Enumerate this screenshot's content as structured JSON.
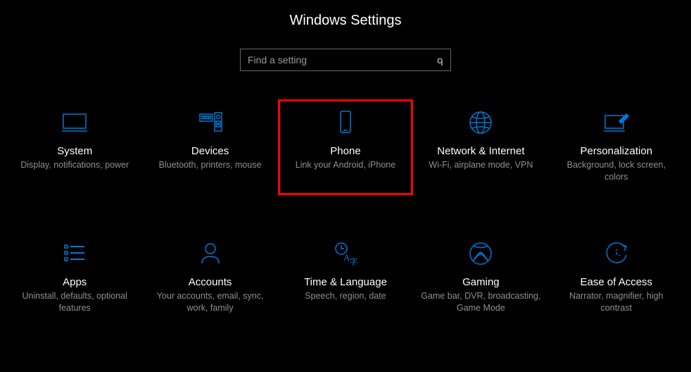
{
  "title": "Windows Settings",
  "search": {
    "placeholder": "Find a setting"
  },
  "tiles": [
    {
      "id": "system",
      "title": "System",
      "desc": "Display, notifications, power",
      "highlighted": false
    },
    {
      "id": "devices",
      "title": "Devices",
      "desc": "Bluetooth, printers, mouse",
      "highlighted": false
    },
    {
      "id": "phone",
      "title": "Phone",
      "desc": "Link your Android, iPhone",
      "highlighted": true
    },
    {
      "id": "network",
      "title": "Network & Internet",
      "desc": "Wi-Fi, airplane mode, VPN",
      "highlighted": false
    },
    {
      "id": "personalization",
      "title": "Personalization",
      "desc": "Background, lock screen, colors",
      "highlighted": false
    },
    {
      "id": "apps",
      "title": "Apps",
      "desc": "Uninstall, defaults, optional features",
      "highlighted": false
    },
    {
      "id": "accounts",
      "title": "Accounts",
      "desc": "Your accounts, email, sync, work, family",
      "highlighted": false
    },
    {
      "id": "time",
      "title": "Time & Language",
      "desc": "Speech, region, date",
      "highlighted": false
    },
    {
      "id": "gaming",
      "title": "Gaming",
      "desc": "Game bar, DVR, broadcasting, Game Mode",
      "highlighted": false
    },
    {
      "id": "ease",
      "title": "Ease of Access",
      "desc": "Narrator, magnifier, high contrast",
      "highlighted": false
    }
  ],
  "accent": "#0078d4",
  "highlight_border": "#ff0000"
}
